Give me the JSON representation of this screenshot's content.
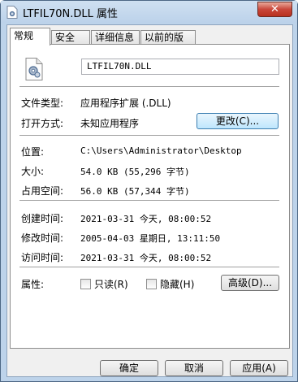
{
  "window": {
    "title": "LTFIL70N.DLL 属性",
    "close_glyph": "✕"
  },
  "tabs": [
    {
      "label": "常规",
      "active": true
    },
    {
      "label": "安全",
      "active": false
    },
    {
      "label": "详细信息",
      "active": false
    },
    {
      "label": "以前的版本",
      "active": false
    }
  ],
  "general": {
    "file_name": "LTFIL70N.DLL",
    "file_type_label": "文件类型:",
    "file_type_value": "应用程序扩展 (.DLL)",
    "open_with_label": "打开方式:",
    "open_with_value": "未知应用程序",
    "change_button": "更改(C)...",
    "location_label": "位置:",
    "location_value": "C:\\Users\\Administrator\\Desktop",
    "size_label": "大小:",
    "size_value": "54.0 KB (55,296 字节)",
    "size_on_disk_label": "占用空间:",
    "size_on_disk_value": "56.0 KB (57,344 字节)",
    "created_label": "创建时间:",
    "created_value": "2021-03-31 今天, 08:00:52",
    "modified_label": "修改时间:",
    "modified_value": "2005-04-03 星期日, 13:11:50",
    "accessed_label": "访问时间:",
    "accessed_value": "2021-03-31 今天, 08:00:52",
    "attributes_label": "属性:",
    "readonly_label": "只读(R)",
    "hidden_label": "隐藏(H)",
    "advanced_button": "高级(D)...",
    "readonly_checked": false,
    "hidden_checked": false
  },
  "footer": {
    "ok": "确定",
    "cancel": "取消",
    "apply": "应用(A)"
  },
  "icons": {
    "app_icon": "dll-file-icon",
    "file_icon": "dll-gear-file-icon"
  }
}
